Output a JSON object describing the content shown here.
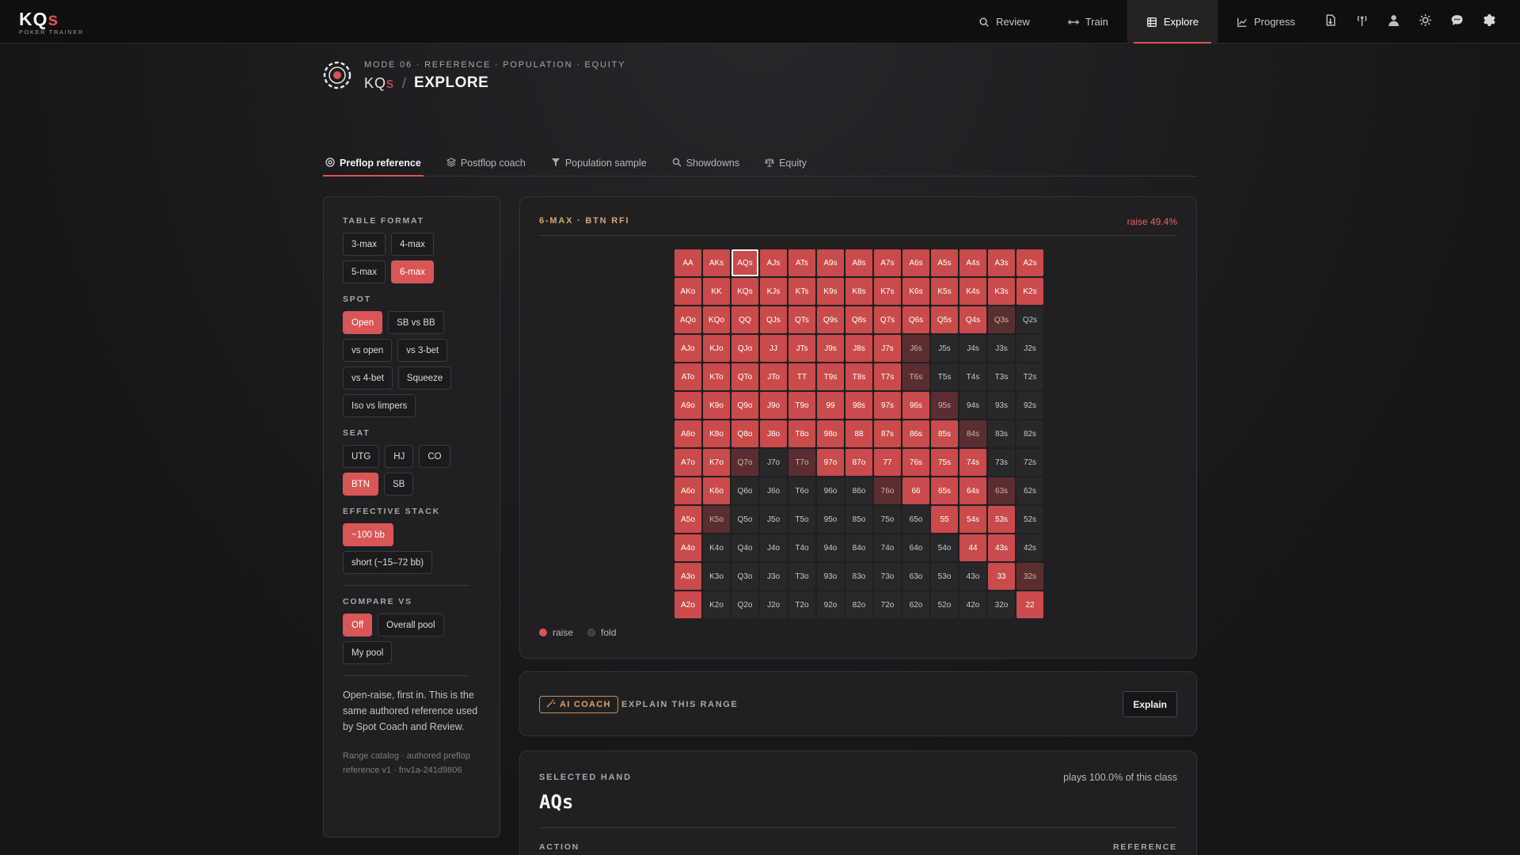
{
  "brand": {
    "logo_main": "KQ",
    "logo_s": "s",
    "logo_sub": "POKER TRAINER"
  },
  "nav": {
    "items": [
      {
        "label": "Review",
        "icon": "search-icon"
      },
      {
        "label": "Train",
        "icon": "dumbbell-icon"
      },
      {
        "label": "Explore",
        "icon": "grid-icon",
        "active": true
      },
      {
        "label": "Progress",
        "icon": "chart-line-icon"
      }
    ],
    "icon_buttons": [
      "import-icon",
      "antenna-icon",
      "user-icon",
      "sun-icon",
      "chat-icon",
      "gear-icon"
    ]
  },
  "header": {
    "breadcrumb": "MODE 06 · REFERENCE · POPULATION · EQUITY",
    "brand_main": "KQ",
    "brand_s": "s",
    "slash": "/",
    "title": "EXPLORE"
  },
  "tabs": [
    {
      "label": "Preflop reference",
      "icon": "target-icon",
      "active": true
    },
    {
      "label": "Postflop coach",
      "icon": "layers-icon"
    },
    {
      "label": "Population sample",
      "icon": "filter-icon"
    },
    {
      "label": "Showdowns",
      "icon": "search-icon"
    },
    {
      "label": "Equity",
      "icon": "scale-icon"
    }
  ],
  "sidebar": {
    "table_format": {
      "label": "TABLE FORMAT",
      "options": [
        "3-max",
        "4-max",
        "5-max",
        "6-max"
      ],
      "selected": "6-max"
    },
    "spot": {
      "label": "SPOT",
      "options": [
        "Open",
        "SB vs BB",
        "vs open",
        "vs 3-bet",
        "vs 4-bet",
        "Squeeze",
        "Iso vs limpers"
      ],
      "selected": "Open"
    },
    "seat": {
      "label": "SEAT",
      "options": [
        "UTG",
        "HJ",
        "CO",
        "BTN",
        "SB"
      ],
      "selected": "BTN"
    },
    "stack": {
      "label": "EFFECTIVE STACK",
      "options": [
        "~100 bb",
        "short (~15–72 bb)"
      ],
      "selected": "~100 bb"
    },
    "compare": {
      "label": "COMPARE VS",
      "options": [
        "Off",
        "Overall pool",
        "My pool"
      ],
      "selected": "Off"
    },
    "note": "Open-raise, first in. This is the same authored reference used by Spot Coach and Review.",
    "meta": "Range catalog · authored preflop reference v1 · fnv1a-241d9806"
  },
  "range": {
    "title": "6-MAX · BTN RFI",
    "stat": "raise 49.4%",
    "legend": {
      "raise": "raise",
      "fold": "fold"
    },
    "selected_cell": "AQs",
    "rows": [
      [
        "AA",
        "AKs",
        "AQs",
        "AJs",
        "ATs",
        "A9s",
        "A8s",
        "A7s",
        "A6s",
        "A5s",
        "A4s",
        "A3s",
        "A2s"
      ],
      [
        "AKo",
        "KK",
        "KQs",
        "KJs",
        "KTs",
        "K9s",
        "K8s",
        "K7s",
        "K6s",
        "K5s",
        "K4s",
        "K3s",
        "K2s"
      ],
      [
        "AQo",
        "KQo",
        "QQ",
        "QJs",
        "QTs",
        "Q9s",
        "Q8s",
        "Q7s",
        "Q6s",
        "Q5s",
        "Q4s",
        "Q3s",
        "Q2s"
      ],
      [
        "AJo",
        "KJo",
        "QJo",
        "JJ",
        "JTs",
        "J9s",
        "J8s",
        "J7s",
        "J6s",
        "J5s",
        "J4s",
        "J3s",
        "J2s"
      ],
      [
        "ATo",
        "KTo",
        "QTo",
        "JTo",
        "TT",
        "T9s",
        "T8s",
        "T7s",
        "T6s",
        "T5s",
        "T4s",
        "T3s",
        "T2s"
      ],
      [
        "A9o",
        "K9o",
        "Q9o",
        "J9o",
        "T9o",
        "99",
        "98s",
        "97s",
        "96s",
        "95s",
        "94s",
        "93s",
        "92s"
      ],
      [
        "A8o",
        "K8o",
        "Q8o",
        "J8o",
        "T8o",
        "98o",
        "88",
        "87s",
        "86s",
        "85s",
        "84s",
        "83s",
        "82s"
      ],
      [
        "A7o",
        "K7o",
        "Q7o",
        "J7o",
        "T7o",
        "97o",
        "87o",
        "77",
        "76s",
        "75s",
        "74s",
        "73s",
        "72s"
      ],
      [
        "A6o",
        "K6o",
        "Q6o",
        "J6o",
        "T6o",
        "96o",
        "86o",
        "76o",
        "66",
        "65s",
        "64s",
        "63s",
        "62s"
      ],
      [
        "A5o",
        "K5o",
        "Q5o",
        "J5o",
        "T5o",
        "95o",
        "85o",
        "75o",
        "65o",
        "55",
        "54s",
        "53s",
        "52s"
      ],
      [
        "A4o",
        "K4o",
        "Q4o",
        "J4o",
        "T4o",
        "94o",
        "84o",
        "74o",
        "64o",
        "54o",
        "44",
        "43s",
        "42s"
      ],
      [
        "A3o",
        "K3o",
        "Q3o",
        "J3o",
        "T3o",
        "93o",
        "83o",
        "73o",
        "63o",
        "53o",
        "43o",
        "33",
        "32s"
      ],
      [
        "A2o",
        "K2o",
        "Q2o",
        "J2o",
        "T2o",
        "92o",
        "82o",
        "72o",
        "62o",
        "52o",
        "42o",
        "32o",
        "22"
      ]
    ],
    "states": [
      [
        "r",
        "r",
        "r",
        "r",
        "r",
        "r",
        "r",
        "r",
        "r",
        "r",
        "r",
        "r",
        "r"
      ],
      [
        "r",
        "r",
        "r",
        "r",
        "r",
        "r",
        "r",
        "r",
        "r",
        "r",
        "r",
        "r",
        "r"
      ],
      [
        "r",
        "r",
        "r",
        "r",
        "r",
        "r",
        "r",
        "r",
        "r",
        "r",
        "r",
        "p",
        "f"
      ],
      [
        "r",
        "r",
        "r",
        "r",
        "r",
        "r",
        "r",
        "r",
        "p",
        "f",
        "f",
        "f",
        "f"
      ],
      [
        "r",
        "r",
        "r",
        "r",
        "r",
        "r",
        "r",
        "r",
        "p",
        "f",
        "f",
        "f",
        "f"
      ],
      [
        "r",
        "r",
        "r",
        "r",
        "r",
        "r",
        "r",
        "r",
        "r",
        "p",
        "f",
        "f",
        "f"
      ],
      [
        "r",
        "r",
        "r",
        "r",
        "r",
        "r",
        "r",
        "r",
        "r",
        "r",
        "p",
        "f",
        "f"
      ],
      [
        "r",
        "r",
        "p",
        "f",
        "p",
        "r",
        "r",
        "r",
        "r",
        "r",
        "r",
        "f",
        "f"
      ],
      [
        "r",
        "r",
        "f",
        "f",
        "f",
        "f",
        "f",
        "p",
        "r",
        "r",
        "r",
        "p",
        "f"
      ],
      [
        "r",
        "p",
        "f",
        "f",
        "f",
        "f",
        "f",
        "f",
        "f",
        "r",
        "r",
        "r",
        "f"
      ],
      [
        "r",
        "f",
        "f",
        "f",
        "f",
        "f",
        "f",
        "f",
        "f",
        "f",
        "r",
        "r",
        "f"
      ],
      [
        "r",
        "f",
        "f",
        "f",
        "f",
        "f",
        "f",
        "f",
        "f",
        "f",
        "f",
        "r",
        "p"
      ],
      [
        "r",
        "f",
        "f",
        "f",
        "f",
        "f",
        "f",
        "f",
        "f",
        "f",
        "f",
        "f",
        "r"
      ]
    ]
  },
  "coach": {
    "badge": "AI COACH",
    "label": "EXPLAIN THIS RANGE",
    "button": "Explain"
  },
  "selected_hand": {
    "label": "SELECTED HAND",
    "hand": "AQs",
    "plays": "plays 100.0% of this class",
    "col_action": "ACTION",
    "col_reference": "REFERENCE"
  },
  "colors": {
    "accent": "#d95656",
    "raise": "#c94b4b",
    "partial": "#5a2e30",
    "fold": "#28282b",
    "coach": "#e3a05e"
  }
}
